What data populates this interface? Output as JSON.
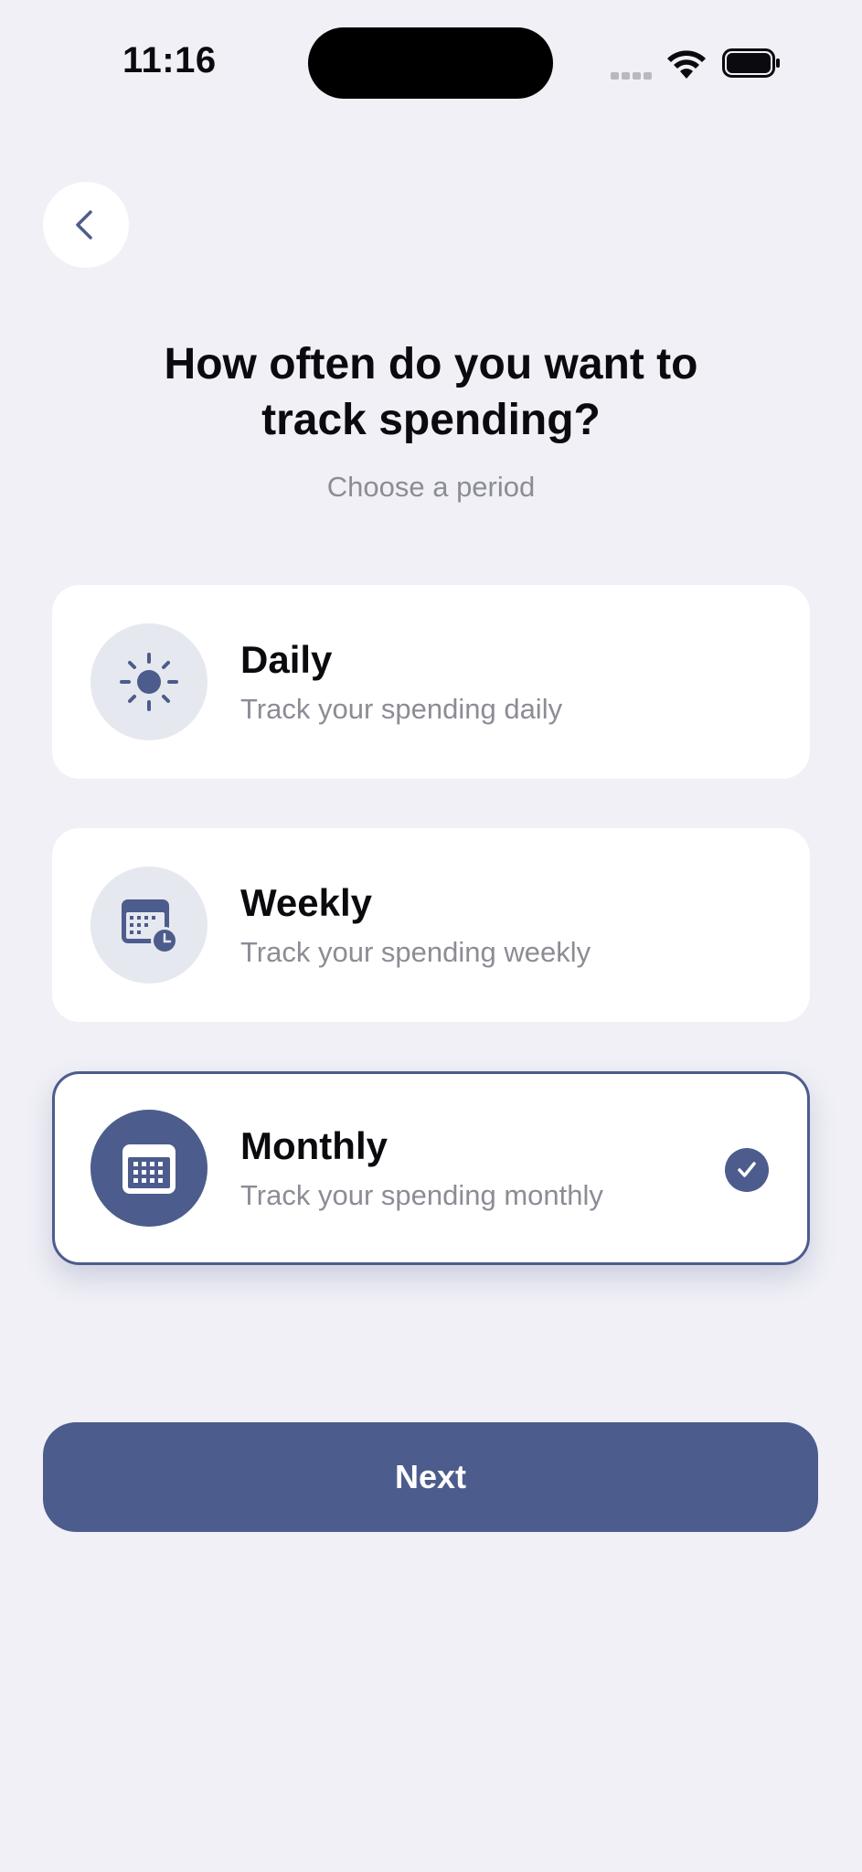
{
  "status_bar": {
    "time": "11:16"
  },
  "header": {
    "title_line1": "How often do you want to",
    "title_line2": "track spending?",
    "subtitle": "Choose a period"
  },
  "options": [
    {
      "title": "Daily",
      "description": "Track your spending daily",
      "icon": "sun-icon",
      "selected": false
    },
    {
      "title": "Weekly",
      "description": "Track your spending weekly",
      "icon": "calendar-clock-icon",
      "selected": false
    },
    {
      "title": "Monthly",
      "description": "Track your spending monthly",
      "icon": "calendar-icon",
      "selected": true
    }
  ],
  "next_button": {
    "label": "Next"
  },
  "colors": {
    "background": "#f0f0f6",
    "accent": "#4c5c8c",
    "icon_bg": "#e6e8f0",
    "secondary_text": "#8c8c96"
  }
}
